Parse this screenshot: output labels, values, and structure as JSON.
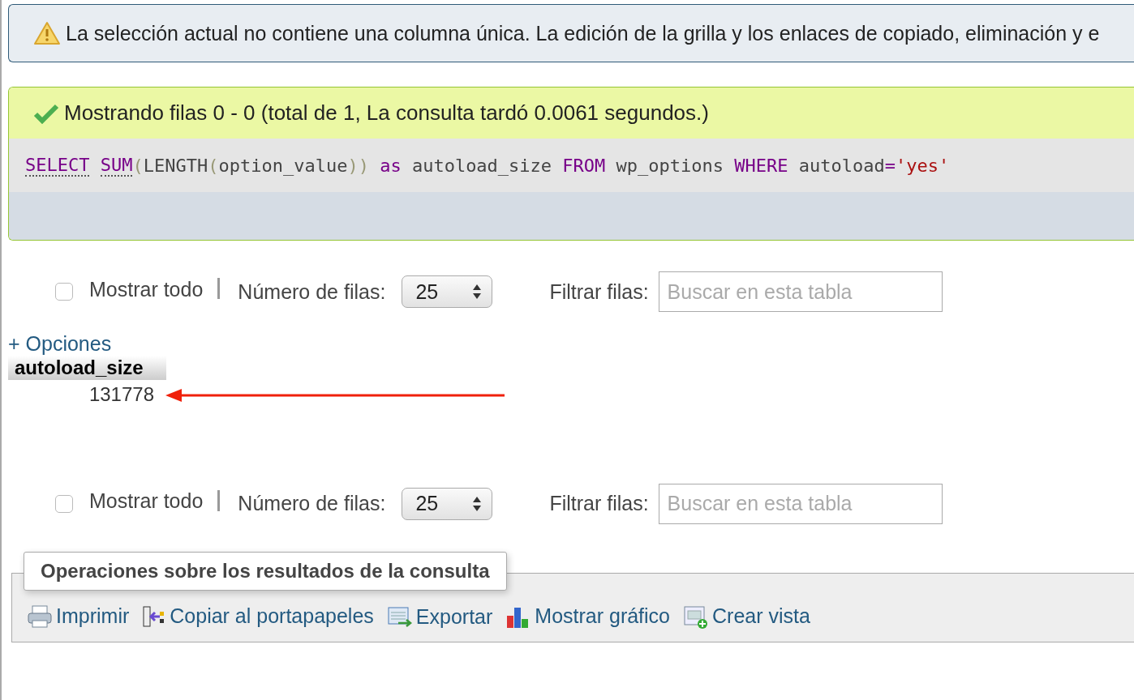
{
  "warning": {
    "text": "La selección actual no contiene una columna única. La edición de la grilla y los enlaces de copiado, eliminación y e"
  },
  "result": {
    "message": "Mostrando filas 0 - 0 (total de 1, La consulta tardó 0.0061 segundos.)",
    "sql": [
      {
        "kind": "keyword",
        "text": "SELECT"
      },
      {
        "kind": "function",
        "text": "SUM"
      },
      {
        "kind": "paren",
        "text": "("
      },
      {
        "kind": "plain",
        "text": "LENGTH"
      },
      {
        "kind": "paren",
        "text": "("
      },
      {
        "kind": "plain",
        "text": "option_value"
      },
      {
        "kind": "paren",
        "text": "))"
      },
      {
        "kind": "keyword",
        "text": " as"
      },
      {
        "kind": "plain",
        "text": " autoload_size "
      },
      {
        "kind": "keyword",
        "text": "FROM"
      },
      {
        "kind": "plain",
        "text": " wp_options "
      },
      {
        "kind": "keyword",
        "text": "WHERE"
      },
      {
        "kind": "plain",
        "text": " autoload"
      },
      {
        "kind": "keyword",
        "text": "="
      },
      {
        "kind": "string",
        "text": "'yes'"
      }
    ]
  },
  "navigation_top": {
    "show_all": {
      "label": "Mostrar todo",
      "checked": false
    },
    "rows_label": "Número de filas:",
    "rows_value": "25",
    "filter_label": "Filtrar filas:",
    "filter_placeholder": "Buscar en esta tabla"
  },
  "options_link": "+ Opciones",
  "table": {
    "columns": [
      "autoload_size"
    ],
    "rows": [
      [
        "131778"
      ]
    ]
  },
  "navigation_bottom": {
    "show_all": {
      "label": "Mostrar todo",
      "checked": false
    },
    "rows_label": "Número de filas:",
    "rows_value": "25",
    "filter_label": "Filtrar filas:",
    "filter_placeholder": "Buscar en esta tabla"
  },
  "operations": {
    "title": "Operaciones sobre los resultados de la consulta",
    "actions": [
      {
        "kind": "print",
        "label": "Imprimir"
      },
      {
        "kind": "copy",
        "label": "Copiar al portapapeles"
      },
      {
        "kind": "export",
        "label": "Exportar"
      },
      {
        "kind": "chart",
        "label": "Mostrar gráfico"
      },
      {
        "kind": "view",
        "label": "Crear vista"
      }
    ]
  }
}
